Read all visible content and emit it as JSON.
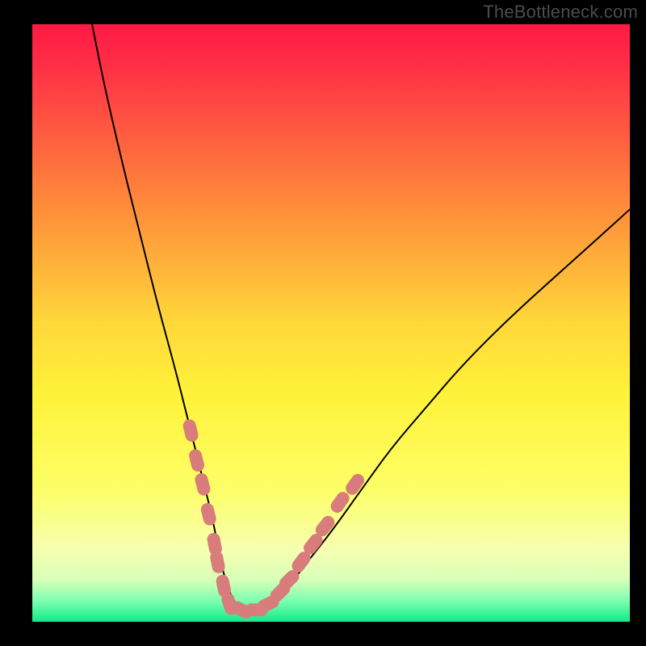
{
  "watermark": "TheBottleneck.com",
  "colors": {
    "frame": "#000000",
    "watermark": "#4c4c4c",
    "curve": "#000000",
    "marker_fill": "#d97c7c",
    "gradient_stops": [
      {
        "offset": 0.0,
        "color": "#ff1a44"
      },
      {
        "offset": 0.07,
        "color": "#ff2f46"
      },
      {
        "offset": 0.3,
        "color": "#ff8a3a"
      },
      {
        "offset": 0.5,
        "color": "#ffd83a"
      },
      {
        "offset": 0.62,
        "color": "#fff23a"
      },
      {
        "offset": 0.78,
        "color": "#fdff68"
      },
      {
        "offset": 0.88,
        "color": "#f6ffb0"
      },
      {
        "offset": 0.93,
        "color": "#d7ffb8"
      },
      {
        "offset": 0.965,
        "color": "#7bffb0"
      },
      {
        "offset": 1.0,
        "color": "#14e98a"
      }
    ]
  },
  "chart_data": {
    "type": "line",
    "title": "",
    "xlabel": "",
    "ylabel": "",
    "xlim": [
      0,
      100
    ],
    "ylim": [
      0,
      100
    ],
    "grid": false,
    "legend": false,
    "series": [
      {
        "name": "bottleneck-curve",
        "x": [
          10,
          12,
          15,
          18,
          21,
          24,
          26,
          28,
          30,
          31,
          32,
          33,
          34,
          36,
          38,
          40,
          43,
          46,
          50,
          55,
          60,
          66,
          72,
          80,
          90,
          100
        ],
        "y": [
          100,
          90,
          77,
          65,
          53,
          42,
          34,
          26,
          18,
          13,
          8,
          5,
          3,
          2,
          2,
          3,
          6,
          10,
          15,
          22,
          29,
          36,
          43,
          51,
          60,
          69
        ]
      }
    ],
    "markers": [
      {
        "x": 26.5,
        "y": 32
      },
      {
        "x": 27.5,
        "y": 27
      },
      {
        "x": 28.5,
        "y": 23
      },
      {
        "x": 29.5,
        "y": 18
      },
      {
        "x": 30.5,
        "y": 13
      },
      {
        "x": 31.0,
        "y": 10
      },
      {
        "x": 32.0,
        "y": 6
      },
      {
        "x": 33.0,
        "y": 3
      },
      {
        "x": 35.0,
        "y": 2
      },
      {
        "x": 37.5,
        "y": 2
      },
      {
        "x": 39.5,
        "y": 3
      },
      {
        "x": 41.5,
        "y": 5
      },
      {
        "x": 43.0,
        "y": 7
      },
      {
        "x": 45.0,
        "y": 10
      },
      {
        "x": 47.0,
        "y": 13
      },
      {
        "x": 49.0,
        "y": 16
      },
      {
        "x": 51.5,
        "y": 20
      },
      {
        "x": 54.0,
        "y": 23
      }
    ]
  }
}
